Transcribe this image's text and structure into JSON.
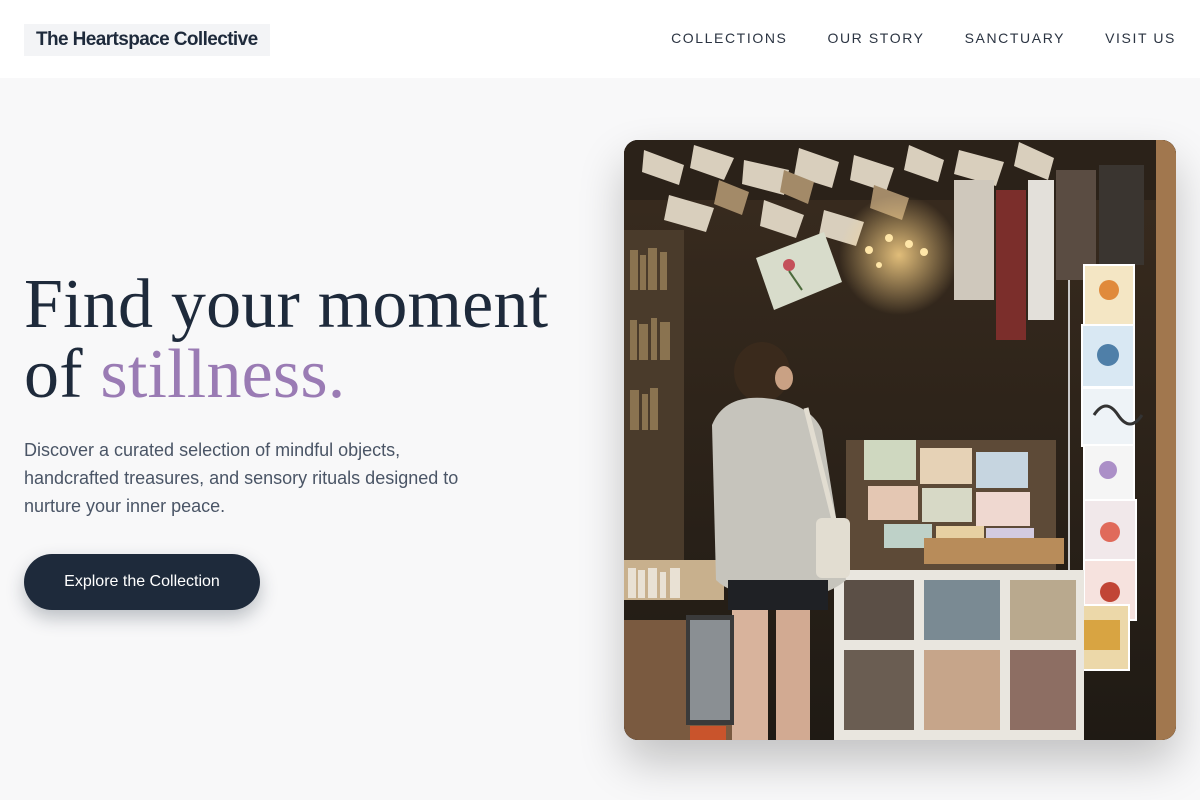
{
  "header": {
    "brand": "The Heartspace Collective",
    "nav": [
      {
        "label": "COLLECTIONS"
      },
      {
        "label": "OUR STORY"
      },
      {
        "label": "SANCTUARY"
      },
      {
        "label": "VISIT US"
      }
    ]
  },
  "hero": {
    "headline_line1": "Find your moment",
    "headline_of": "of",
    "headline_accent": "stillness.",
    "description": "Discover a curated selection of mindful objects, handcrafted treasures, and sensory rituals designed to nurture your inner peace.",
    "cta_label": "Explore the Collection",
    "image_subject": "woman browsing postcards and books in a cozy bookshop with books hanging from the ceiling"
  },
  "colors": {
    "primary": "#1e2a3b",
    "accent": "#9a7bb4",
    "background": "#f8f8f9",
    "text_muted": "#4a5566"
  }
}
